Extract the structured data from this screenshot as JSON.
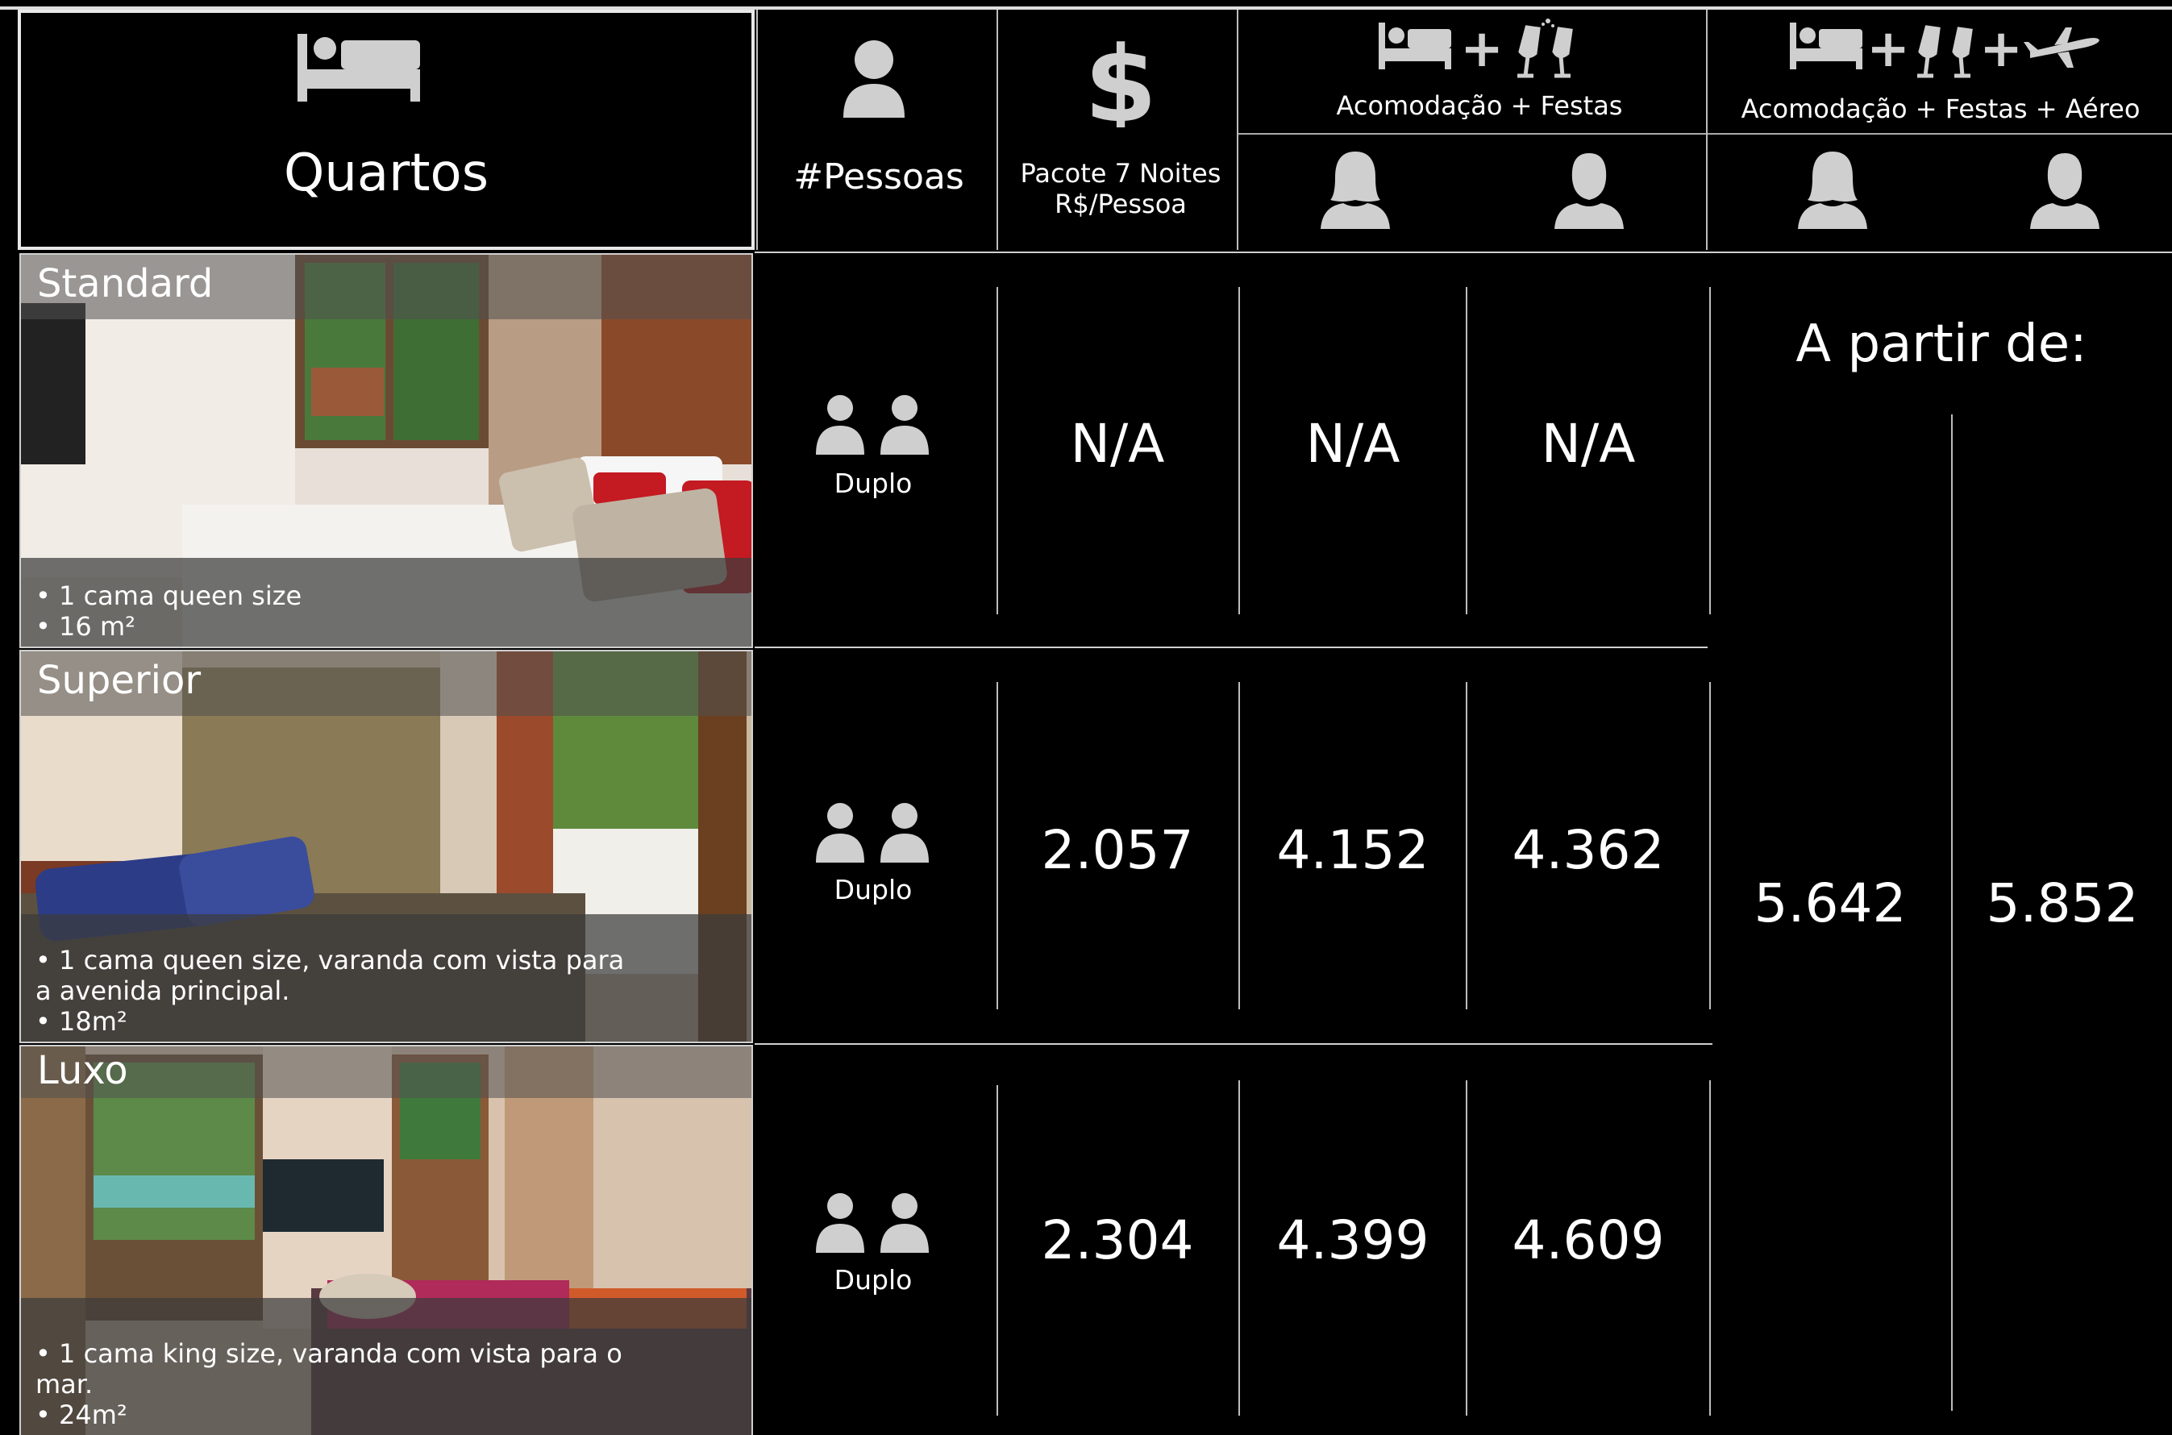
{
  "header": {
    "rooms_label": "Quartos",
    "people_label": "#Pessoas",
    "package_line1": "Pacote 7 Noites",
    "package_line2": "R$/Pessoa",
    "group1_label": "Acomodação + Festas",
    "group2_label": "Acomodação + Festas + Aéreo",
    "icons": [
      "bed-icon",
      "person-icon",
      "dollar-icon",
      "champagne-icon",
      "airplane-icon",
      "female-icon",
      "male-icon"
    ]
  },
  "rooms": [
    {
      "name": "Standard",
      "people": "Duplo",
      "package": "N/A",
      "festas_female": "N/A",
      "festas_male": "N/A",
      "desc": [
        "• 1 cama queen size",
        "• 16 m²"
      ]
    },
    {
      "name": "Superior",
      "people": "Duplo",
      "package": "2.057",
      "festas_female": "4.152",
      "festas_male": "4.362",
      "desc": [
        "• 1 cama queen size, varanda com vista para a avenida principal.",
        "• 18m²"
      ]
    },
    {
      "name": "Luxo",
      "people": "Duplo",
      "package": "2.304",
      "festas_female": "4.399",
      "festas_male": "4.609",
      "desc": [
        "• 1 cama king size, varanda com vista para o mar.",
        "• 24m²"
      ]
    }
  ],
  "aereo": {
    "label": "A partir de:",
    "female_price": "5.642",
    "male_price": "5.852"
  }
}
